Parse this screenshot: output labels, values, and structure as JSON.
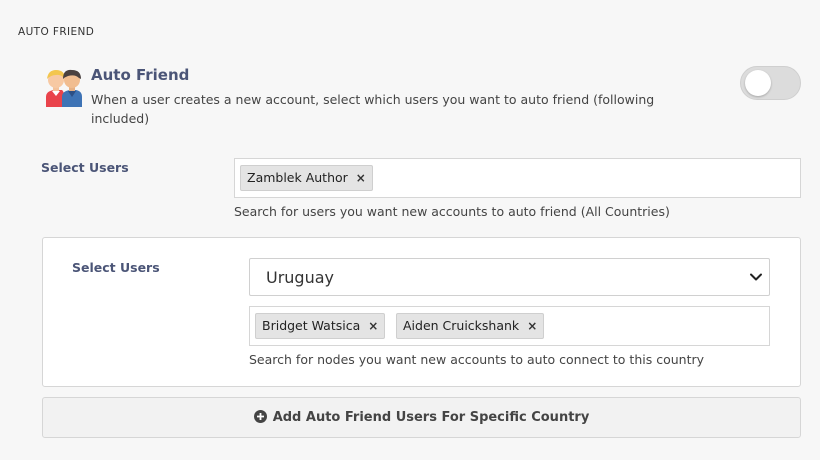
{
  "section": {
    "title": "AUTO FRIEND"
  },
  "auto_friend": {
    "title": "Auto Friend",
    "description": "When a user creates a new account, select which users you want to auto friend (following included)",
    "toggle_on": false
  },
  "global_users": {
    "label": "Select Users",
    "selected": [
      "Zamblek Author"
    ],
    "help": "Search for users you want new accounts to auto friend (All Countries)"
  },
  "country_users": {
    "label": "Select Users",
    "country": "Uruguay",
    "selected": [
      "Bridget Watsica",
      "Aiden Cruickshank"
    ],
    "help": "Search for nodes you want new accounts to auto connect to this country"
  },
  "add_button": {
    "label": "Add Auto Friend Users For Specific Country"
  },
  "icons": {
    "header": "people-icon",
    "remove": "close-x-icon",
    "dropdown": "chevron-down-icon",
    "add": "plus-circle-icon"
  },
  "colors": {
    "label": "#4b5577",
    "toggle_off": "#dcdcdc"
  }
}
